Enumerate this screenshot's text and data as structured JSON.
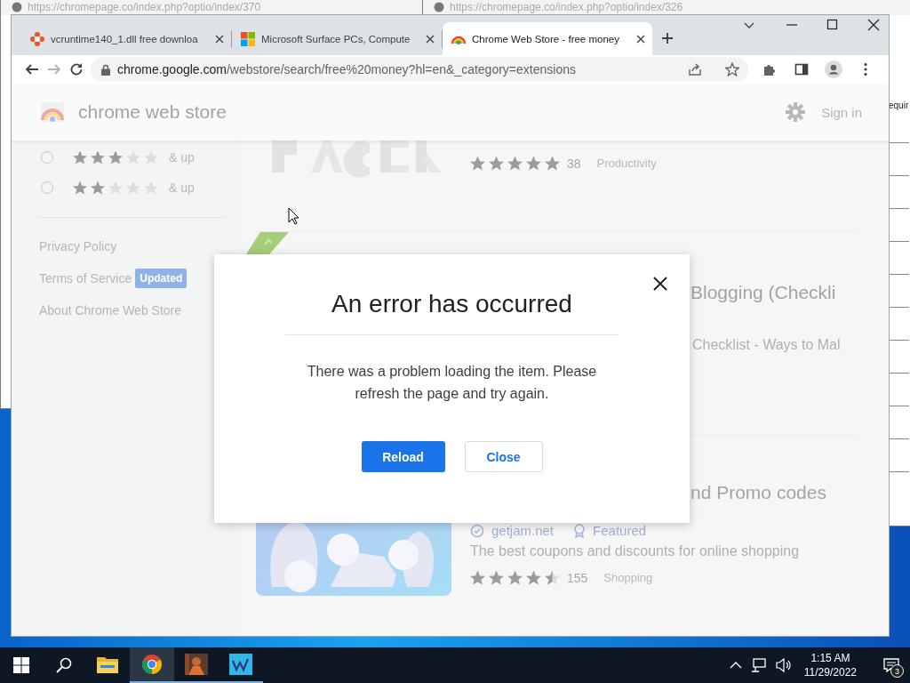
{
  "background_windows": [
    {
      "url": "https://chromepage.co/index.php?optio/index/370"
    },
    {
      "url": "https://chromepage.co/index.php?optio/index/326",
      "fragment": "equir"
    }
  ],
  "browser": {
    "tabs": [
      {
        "title": "vcruntime140_1.dll free downloa",
        "selected": false
      },
      {
        "title": "Microsoft Surface PCs, Compute",
        "selected": false
      },
      {
        "title": "Chrome Web Store - free money",
        "selected": true
      }
    ],
    "url_host": "chrome.google.com",
    "url_path": "/webstore/search/free%20money?hl=en&_category=extensions"
  },
  "store": {
    "brand": "chrome web store",
    "sign_in": "Sign in",
    "rating_filters": [
      {
        "stars": 3,
        "label": "& up",
        "selected": false
      },
      {
        "stars": 2,
        "label": "& up",
        "selected": false
      }
    ],
    "footer_links": [
      {
        "label": "Privacy Policy"
      },
      {
        "label": "Terms of Service",
        "badge": "Updated"
      },
      {
        "label": "About Chrome Web Store"
      }
    ],
    "results": [
      {
        "kind": "rated",
        "stars": 5,
        "count": "38",
        "category": "Productivity"
      },
      {
        "kind": "featured",
        "title": "Blogging (Checkli",
        "description": "Checklist - Ways to Mal"
      },
      {
        "kind": "full",
        "title": "nd Promo codes",
        "site": "getjam.net",
        "badge": "Featured",
        "description": "The best coupons and discounts for online shopping",
        "stars": 4.5,
        "count": "155",
        "category": "Shopping"
      }
    ]
  },
  "dialog": {
    "title": "An error has occurred",
    "message": "There was a problem loading the item. Please refresh the page and try again.",
    "buttons": [
      {
        "label": "Reload",
        "kind": "primary"
      },
      {
        "label": "Close",
        "kind": "secondary"
      }
    ]
  },
  "taskbar": {
    "apps": [
      {
        "selected": false
      },
      {
        "selected": true
      },
      {
        "selected": false
      },
      {
        "selected": false
      }
    ],
    "time": "1:15 AM",
    "date": "11/29/2022",
    "notifications": "3"
  }
}
